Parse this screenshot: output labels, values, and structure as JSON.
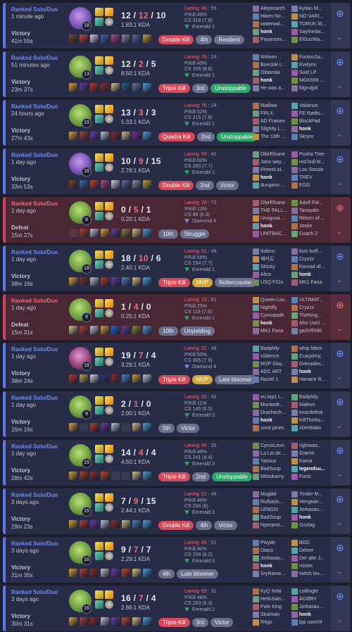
{
  "matches": [
    {
      "result": "Victory",
      "queue": "Ranked Solo/Duo",
      "ago": "1 minute ago",
      "duration": "41m 55s",
      "champ": "c2",
      "level": "18",
      "k": "12",
      "d": "12",
      "a": "10",
      "kda": "1.83:1 KDA",
      "badges": [
        {
          "text": "Double Kill",
          "style": "red"
        },
        {
          "text": "4th",
          "style": "grey"
        },
        {
          "text": "Resilient",
          "style": "grey"
        }
      ],
      "laning": "48",
      "laning_n": "55",
      "pk": "P/Kill 49%",
      "cs": "CS 318 (7.6)",
      "rank": "Emerald 1",
      "rank_tier": "emerald",
      "items": [
        "#7a4a2a",
        "#c9472e",
        "#d6d4e8",
        "#3e6bb8",
        "#b34c8c",
        "#8a8fa8",
        "#5b6d9c",
        "#c7a33a"
      ],
      "blue": [
        "Alepecarch",
        "Hiken No ...",
        "waterwal...",
        "honk",
        "Payansini..."
      ],
      "red": [
        "Kylian M...",
        "NO VARI...",
        "TORUK M...",
        "Saythedw...",
        "ElGusWa..."
      ],
      "me": 3
    },
    {
      "result": "Victory",
      "queue": "Ranked Solo/Duo",
      "ago": "51 minutes ago",
      "duration": "23m 37s",
      "champ": "c1",
      "level": "13",
      "k": "12",
      "d": "2",
      "a": "5",
      "kda": "8.50:1 KDA",
      "badges": [
        {
          "text": "Triple Kill",
          "style": "red"
        },
        {
          "text": "3rd",
          "style": "grey"
        },
        {
          "text": "Unstoppable",
          "style": "green"
        }
      ],
      "laning": "76",
      "laning_n": "24",
      "pk": "P/Kill 49%",
      "cs": "CS 209 (8.8)",
      "rank": "Emerald 1",
      "rank_tier": "emerald",
      "items": [
        "#d9a43c",
        "#6b3da8",
        "#b8402e",
        "#8f2d2d",
        "#d6c48a",
        "#1f6b8f",
        "#6d77a6",
        "#4aa3d8"
      ],
      "blue": [
        "Wolven",
        "Boeckle I...",
        "Oldamila",
        "honk",
        "He was a..."
      ],
      "red": [
        "FoutouSa...",
        "Evelynn",
        "Sold LP",
        "MGK666 ...",
        "fdgrutjyti"
      ],
      "me": 3
    },
    {
      "result": "Victory",
      "queue": "Ranked Solo/Duo",
      "ago": "24 hours ago",
      "duration": "27m 43s",
      "champ": "c1",
      "level": "15",
      "k": "13",
      "d": "3",
      "a": "3",
      "kda": "5.33:1 KDA",
      "badges": [
        {
          "text": "Quadra Kill",
          "style": "red"
        },
        {
          "text": "2nd",
          "style": "grey"
        },
        {
          "text": "Unstoppable",
          "style": "green"
        }
      ],
      "laning": "76",
      "laning_n": "24",
      "pk": "P/Kill 52%",
      "cs": "CS 215 (7.8)",
      "rank": "Emerald 1",
      "rank_tier": "emerald",
      "items": [
        "#d9a43c",
        "#b8402e",
        "#6b3da8",
        "#c0c4d8",
        "#8f2d2d",
        "#d6c48a",
        "#7c2f9e",
        "#4aa3d8"
      ],
      "blue": [
        "Maillow",
        "FRLX",
        "AD Fraisex",
        "Slightly L...",
        "The 13th ..."
      ],
      "red": [
        "Valainon",
        "FE Rødto...",
        "BlockPad",
        "honk",
        "Skryre"
      ],
      "me": 8
    },
    {
      "result": "Victory",
      "queue": "Ranked Solo/Duo",
      "ago": "1 day ago",
      "duration": "33m 53s",
      "champ": "c2",
      "level": "16",
      "k": "10",
      "d": "9",
      "a": "15",
      "kda": "2.78:1 KDA",
      "badges": [
        {
          "text": "Double Kill",
          "style": "red"
        },
        {
          "text": "2nd",
          "style": "grey"
        },
        {
          "text": "Victor",
          "style": "grey"
        }
      ],
      "laning": "59",
      "laning_n": "41",
      "pk": "P/Kill 60%",
      "cs": "CS 260 (7.7)",
      "rank": "Emerald 1",
      "rank_tier": "emerald",
      "items": [
        "#7a4a2a",
        "#3e6bb8",
        "#c9472e",
        "#b34c8c",
        "#d6d4e8",
        "#5b6d9c",
        "#8a8fa8",
        "#c7a33a"
      ],
      "blue": [
        "ObirEfsane",
        "Jano way...",
        "FireeeLoL",
        "honk",
        "dungeon ..."
      ],
      "red": [
        "Pusha Tree",
        "red bull bl...",
        "Lou Sassle",
        "TREV",
        "EGG"
      ],
      "me": 3
    },
    {
      "result": "Defeat",
      "queue": "Ranked Solo/Duo",
      "ago": "1 day ago",
      "duration": "15m 27s",
      "champ": "c1",
      "level": "8",
      "k": "0",
      "d": "5",
      "a": "1",
      "kda": "0.20:1 KDA",
      "badges": [
        {
          "text": "10th",
          "style": "grey"
        },
        {
          "text": "Struggle",
          "style": "grey"
        }
      ],
      "laning": "28",
      "laning_n": "72",
      "pk": "P/Kill 13%",
      "cs": "CS 98 (6.3)",
      "rank": "Diamond 4",
      "rank_tier": "plat",
      "items": [
        "",
        "#b8402e",
        "#c0c4d8",
        "#d9a43c",
        "#6b3da8",
        "#8f8a3a",
        "#d6c48a",
        "#4aa3d8"
      ],
      "blue": [
        "ObirEfsane",
        "THE FALL...",
        "Urvigosa ...",
        "honk",
        "UNITBAC..."
      ],
      "red": [
        "Adolf Fid...",
        "Tanaydin",
        "Return of ...",
        "Jocke",
        "Coach Z"
      ],
      "me": 3
    },
    {
      "result": "Victory",
      "queue": "Ranked Solo/Duo",
      "ago": "1 day ago",
      "duration": "38m 16s",
      "champ": "c1",
      "level": "18",
      "k": "18",
      "d": "10",
      "a": "6",
      "kda": "2.40:1 KDA",
      "badges": [
        {
          "text": "Triple Kill",
          "style": "red"
        },
        {
          "text": "MVP",
          "style": "gold"
        },
        {
          "text": "Rollercoaster",
          "style": "grey"
        }
      ],
      "laning": "51",
      "laning_n": "49",
      "pk": "P/Kill 59%",
      "cs": "CS 294 (7.7)",
      "rank": "Emerald 1",
      "rank_tier": "emerald",
      "items": [
        "#d9a43c",
        "#8f2d2d",
        "#c0c4d8",
        "#b8402e",
        "#6b3da8",
        "#4a88c7",
        "#d6c48a",
        "#4aa3d8"
      ],
      "blue": [
        "Itsbino",
        "페미도",
        "Shicky",
        "Alice",
        "USQ F31x"
      ],
      "red": [
        "tism buff...",
        "Cryzzz",
        "Konrad 4f...",
        "honk",
        "MK1 Fana"
      ],
      "me": 8
    },
    {
      "result": "Defeat",
      "queue": "Ranked Solo/Duo",
      "ago": "1 day ago",
      "duration": "15m 31s",
      "champ": "c1",
      "level": "9",
      "k": "1",
      "d": "4",
      "a": "0",
      "kda": "0.25:1 KDA",
      "badges": [
        {
          "text": "10th",
          "style": "grey"
        },
        {
          "text": "Unyielding",
          "style": "grey"
        }
      ],
      "laning": "19",
      "laning_n": "81",
      "pk": "P/Kill 25%",
      "cs": "CS 118 (7.6)",
      "rank": "Emerald 1",
      "rank_tier": "emerald",
      "items": [
        "#d6c48a",
        "#b8402e",
        "#c0c4d8",
        "#d9a43c",
        "#1f6bd8",
        "#6b3da8",
        "#8f8a3a",
        "#4aa3d8"
      ],
      "blue": [
        "Queen Lou",
        "Nightfly",
        "Cyncopath",
        "honk",
        "MK1 Fana"
      ],
      "red": [
        "ULTIMAT...",
        "Cryzzz",
        "TheKing...",
        "Ahri UwU ...",
        "gaSVENtil"
      ],
      "me": 3
    },
    {
      "result": "Victory",
      "queue": "Ranked Solo/Duo",
      "ago": "1 day ago",
      "duration": "38m 24s",
      "champ": "c3",
      "level": "18",
      "k": "19",
      "d": "7",
      "a": "4",
      "kda": "3.29:1 KDA",
      "badges": [
        {
          "text": "Triple Kill",
          "style": "red"
        },
        {
          "text": "MVP",
          "style": "gold"
        },
        {
          "text": "Late bloomer",
          "style": "grey"
        }
      ],
      "laning": "52",
      "laning_n": "48",
      "pk": "P/Kill 50%",
      "cs": "CS 305 (7.9)",
      "rank": "Diamond 4",
      "rank_tier": "plat",
      "items": [
        "#b23d3d",
        "#c9a04a",
        "#d6d4e8",
        "#2e3a78",
        "#8f2d2d",
        "#4a88c7",
        "#c7a33a",
        "#c0c4d8"
      ],
      "blue": [
        "Badphily",
        "xSilence",
        "MVP Slay...",
        "ADC ART",
        "Raziel 1"
      ],
      "red": [
        "whip black",
        "Σωκράτης",
        "Grenades...",
        "honk",
        "Hanane R..."
      ],
      "me": 8
    },
    {
      "result": "Victory",
      "queue": "Ranked Solo/Duo",
      "ago": "1 day ago",
      "duration": "15m 16s",
      "champ": "c1",
      "level": "9",
      "k": "2",
      "d": "1",
      "a": "0",
      "kda": "2.00:1 KDA",
      "badges": [
        {
          "text": "5th",
          "style": "grey"
        },
        {
          "text": "Victor",
          "style": "grey"
        }
      ],
      "laning": "59",
      "laning_n": "41",
      "pk": "P/Kill 11%",
      "cs": "CS 145 (9.5)",
      "rank": "Emerald 3",
      "rank_tier": "emerald",
      "items": [
        "#d9a43c",
        "",
        "#b8402e",
        "#6b3da8",
        "#c0c4d8",
        "",
        "#d6c48a",
        "#4aa3d8"
      ],
      "blue": [
        "eu top1 t...",
        "Munkedr...",
        "Drachech...",
        "honk",
        "smol pines"
      ],
      "red": [
        "Badphily",
        "Malevo",
        "exactlethal",
        "KillTheNo...",
        "xDerBabo"
      ],
      "me": 3
    },
    {
      "result": "Victory",
      "queue": "Ranked Solo/Duo",
      "ago": "1 day ago",
      "duration": "28m 42s",
      "champ": "c1",
      "level": "15",
      "k": "14",
      "d": "4",
      "a": "4",
      "kda": "4.50:1 KDA",
      "badges": [
        {
          "text": "Triple Kill",
          "style": "red"
        },
        {
          "text": "2nd",
          "style": "grey"
        },
        {
          "text": "Unstoppable",
          "style": "green"
        }
      ],
      "laning": "65",
      "laning_n": "35",
      "pk": "P/Kill 49%",
      "cs": "CS 241 (8.4)",
      "rank": "Emerald 3",
      "rank_tier": "emerald",
      "items": [
        "#d9a43c",
        "#b8402e",
        "#8f2d2d",
        "#c9472e",
        "",
        "",
        "#d6c48a",
        "#4aa3d8"
      ],
      "blue": [
        "CyrusLeon",
        "La Loi de ...",
        "Yassuo",
        "BadSoup",
        "Mitsukamy"
      ],
      "red": [
        "rightwas...",
        "Grømit",
        "Karna",
        "legendsu...",
        "Focis"
      ],
      "me": 8
    },
    {
      "result": "Victory",
      "queue": "Ranked Solo/Duo",
      "ago": "3 days ago",
      "duration": "29m 23s",
      "champ": "c1",
      "level": "15",
      "k": "7",
      "d": "9",
      "a": "15",
      "kda": "2.44:1 KDA",
      "badges": [
        {
          "text": "Double Kill",
          "style": "red"
        },
        {
          "text": "4th",
          "style": "grey"
        },
        {
          "text": "Victor",
          "style": "grey"
        }
      ],
      "laning": "52",
      "laning_n": "48",
      "pk": "P/Kill 49%",
      "cs": "CS 234 (8)",
      "rank": "Emerald 3",
      "rank_tier": "emerald",
      "items": [
        "#d9a43c",
        "#b8402e",
        "#6b3da8",
        "#c0c4d8",
        "#8f2d2d",
        "#d6c48a",
        "#4a88c7",
        "#4aa3d8"
      ],
      "blue": [
        "Muglati",
        "Rullstols...",
        "LEN020",
        "BadSoup",
        "hiperprot..."
      ],
      "red": [
        "Tinder M...",
        "Vengean...",
        "Jorkasau...",
        "honk",
        "Gozlag"
      ],
      "me": 8
    },
    {
      "result": "Victory",
      "queue": "Ranked Solo/Duo",
      "ago": "3 days ago",
      "duration": "31m 35s",
      "champ": "c1",
      "level": "16",
      "k": "9",
      "d": "7",
      "a": "7",
      "kda": "2.29:1 KDA",
      "badges": [
        {
          "text": "4th",
          "style": "grey"
        },
        {
          "text": "Late bloomer",
          "style": "grey"
        }
      ],
      "laning": "49",
      "laning_n": "51",
      "pk": "P/Kill 40%",
      "cs": "CS 258 (8.2)",
      "rank": "Emerald 3",
      "rank_tier": "emerald",
      "items": [
        "#d9a43c",
        "#b8402e",
        "#8f2d2d",
        "#c0c4d8",
        "#6b3da8",
        "#c9472e",
        "#d6c48a",
        "#4aa3d8"
      ],
      "blue": [
        "Pixyde",
        "Diaco",
        "Jorkasau...",
        "honk",
        "SryName..."
      ],
      "red": [
        "BDD",
        "Delver",
        "Der alte J...",
        "rnister",
        "twitch lov..."
      ],
      "me": 3
    },
    {
      "result": "Victory",
      "queue": "Ranked Solo/Duo",
      "ago": "3 days ago",
      "duration": "30m 31s",
      "champ": "c1",
      "level": "16",
      "k": "16",
      "d": "7",
      "a": "4",
      "kda": "2.86:1 KDA",
      "badges": [
        {
          "text": "Triple Kill",
          "style": "red"
        },
        {
          "text": "3rd",
          "style": "grey"
        },
        {
          "text": "Victor",
          "style": "grey"
        }
      ],
      "laning": "69",
      "laning_n": "31",
      "pk": "P/Kill 48%",
      "cs": "CS 253 (8.3)",
      "rank": "Emerald 2",
      "rank_tier": "emerald",
      "items": [
        "#d9a43c",
        "#b8402e",
        "#8f2d2d",
        "#c0c4d8",
        "#6b3da8",
        "#c9472e",
        "#d6c48a",
        "#4aa3d8"
      ],
      "blue": [
        "KyQ Xela",
        "HellsSain...",
        "Pale King",
        "Skalman",
        "R4gs"
      ],
      "red": [
        "csillinger",
        "ÄGØRY",
        "Jorkasau...",
        "honk",
        "lpp user04"
      ],
      "me": 8
    }
  ],
  "labels": {
    "laning": "Laning",
    "action_icon": "⊕",
    "chevron": "⌄"
  }
}
